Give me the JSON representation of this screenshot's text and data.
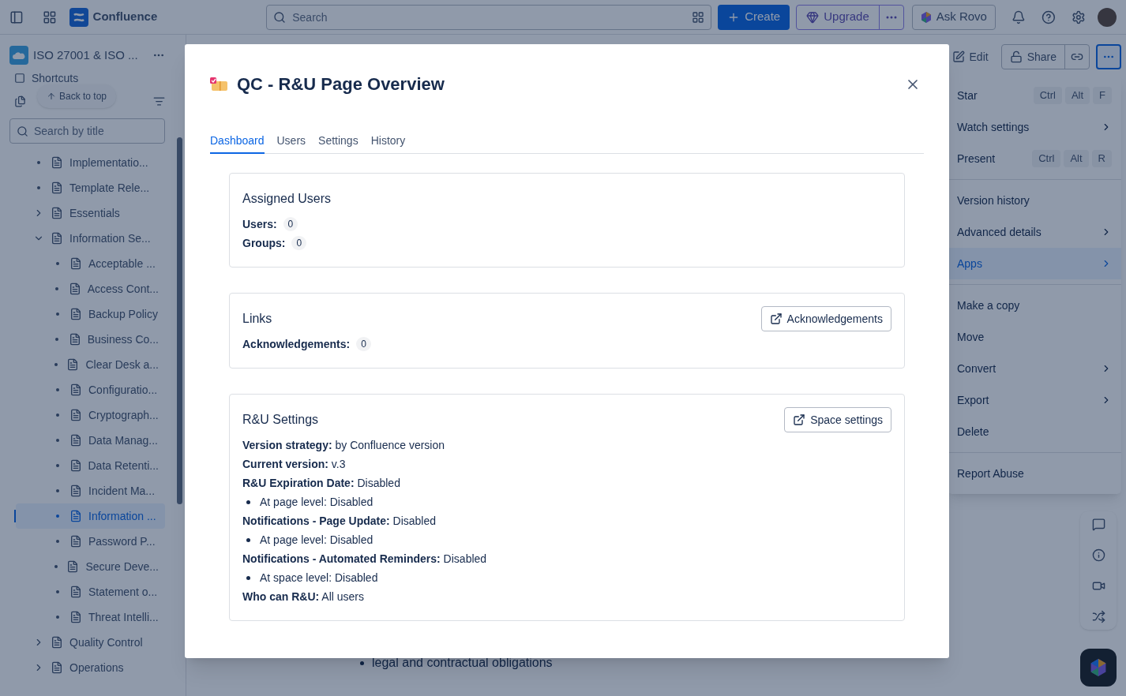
{
  "topbar": {
    "product": "Confluence",
    "search_placeholder": "Search",
    "create": "Create",
    "upgrade": "Upgrade",
    "ask_rovo": "Ask Rovo"
  },
  "sidebar": {
    "space": "ISO 27001 & ISO ...",
    "shortcuts": "Shortcuts",
    "back_to_top": "Back to top",
    "search_placeholder": "Search by title",
    "tree": [
      {
        "label": "Implementatio...",
        "kind": "page",
        "selected": false
      },
      {
        "label": "Template Rele...",
        "kind": "page",
        "selected": false
      },
      {
        "label": "Essentials",
        "kind": "folder",
        "expanded": false,
        "selected": false
      },
      {
        "label": "Information Se...",
        "kind": "folder",
        "expanded": true,
        "selected": false,
        "children": [
          {
            "label": "Acceptable ...",
            "kind": "page",
            "selected": false
          },
          {
            "label": "Access Cont...",
            "kind": "page",
            "selected": false
          },
          {
            "label": "Backup Policy",
            "kind": "page",
            "selected": false
          },
          {
            "label": "Business Co...",
            "kind": "page",
            "selected": false
          },
          {
            "label": "Clear Desk a...",
            "kind": "page",
            "selected": false
          },
          {
            "label": "Configuratio...",
            "kind": "page",
            "selected": false
          },
          {
            "label": "Cryptograph...",
            "kind": "page",
            "selected": false
          },
          {
            "label": "Data Manag...",
            "kind": "page",
            "selected": false
          },
          {
            "label": "Data Retenti...",
            "kind": "page",
            "selected": false
          },
          {
            "label": "Incident Ma...",
            "kind": "page",
            "selected": false
          },
          {
            "label": "Information ...",
            "kind": "page",
            "selected": true
          },
          {
            "label": "Password P...",
            "kind": "page",
            "selected": false
          },
          {
            "label": "Secure Deve...",
            "kind": "page",
            "selected": false
          },
          {
            "label": "Statement o...",
            "kind": "page",
            "selected": false
          },
          {
            "label": "Threat Intelli...",
            "kind": "page",
            "selected": false
          }
        ]
      },
      {
        "label": "Quality Control",
        "kind": "folder",
        "expanded": false,
        "selected": false
      },
      {
        "label": "Operations",
        "kind": "folder",
        "expanded": false,
        "selected": false
      }
    ]
  },
  "page_actions": {
    "edit": "Edit",
    "share": "Share"
  },
  "more_menu": {
    "sections": [
      [
        {
          "label": "Star",
          "kind": "shortcut",
          "keys": [
            "Ctrl",
            "Alt",
            "F"
          ],
          "selected": false
        },
        {
          "label": "Watch settings",
          "kind": "submenu",
          "selected": false
        },
        {
          "label": "Present",
          "kind": "shortcut",
          "keys": [
            "Ctrl",
            "Alt",
            "R"
          ],
          "selected": false
        }
      ],
      [
        {
          "label": "Version history",
          "kind": "plain",
          "selected": false
        },
        {
          "label": "Advanced details",
          "kind": "submenu",
          "selected": false
        },
        {
          "label": "Apps",
          "kind": "submenu",
          "selected": true
        }
      ],
      [
        {
          "label": "Make a copy",
          "kind": "plain",
          "selected": false
        },
        {
          "label": "Move",
          "kind": "plain",
          "selected": false
        },
        {
          "label": "Convert",
          "kind": "submenu",
          "selected": false
        },
        {
          "label": "Export",
          "kind": "submenu",
          "selected": false
        },
        {
          "label": "Delete",
          "kind": "plain",
          "selected": false
        }
      ],
      [
        {
          "label": "Report Abuse",
          "kind": "plain",
          "selected": false
        }
      ]
    ]
  },
  "page_content": {
    "bullet": "legal and contractual obligations"
  },
  "modal": {
    "title": "QC - R&U Page Overview",
    "tabs": [
      {
        "label": "Dashboard",
        "selected": true
      },
      {
        "label": "Users",
        "selected": false
      },
      {
        "label": "Settings",
        "selected": false
      },
      {
        "label": "History",
        "selected": false
      }
    ],
    "cards": [
      {
        "title": "Assigned Users",
        "rows": [
          {
            "kind": "count",
            "label": "Users:",
            "value": "0"
          },
          {
            "kind": "count",
            "label": "Groups:",
            "value": "0"
          }
        ]
      },
      {
        "title": "Links",
        "button": "Acknowledgements",
        "rows": [
          {
            "kind": "count",
            "label": "Acknowledgements:",
            "value": "0"
          }
        ]
      },
      {
        "title": "R&U Settings",
        "button": "Space settings",
        "rows": [
          {
            "kind": "line",
            "text": "**Version strategy:** by Confluence version"
          },
          {
            "kind": "line",
            "text": "**Current version:** v.3"
          },
          {
            "kind": "line",
            "text": "**R&U Expiration Date:** Disabled"
          },
          {
            "kind": "bullet",
            "text": "At page level: Disabled"
          },
          {
            "kind": "line",
            "text": "**Notifications - Page Update:** Disabled"
          },
          {
            "kind": "bullet",
            "text": "At page level: Disabled"
          },
          {
            "kind": "line",
            "text": "**Notifications - Automated Reminders:** Disabled"
          },
          {
            "kind": "bullet",
            "text": "At space level: Disabled"
          },
          {
            "kind": "line",
            "text": "**Who can R&U:** All users"
          }
        ]
      }
    ]
  }
}
